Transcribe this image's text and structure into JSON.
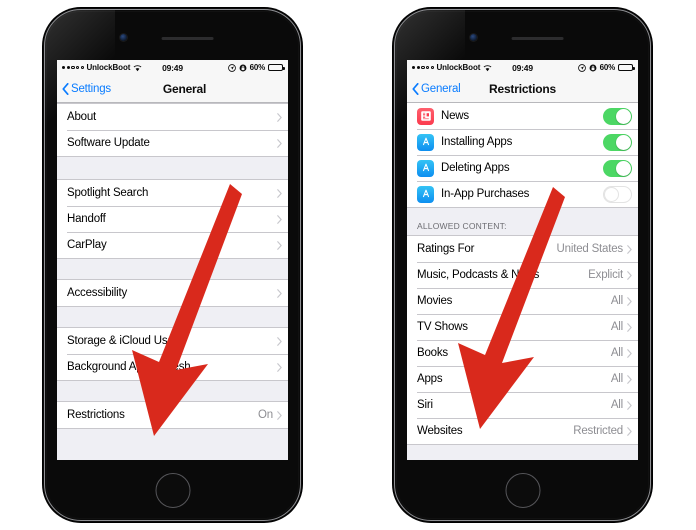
{
  "status_bar": {
    "carrier": "UnlockBoot",
    "time": "09:49",
    "battery_pct": "60%",
    "signal_dots_filled": 2,
    "signal_dots_total": 5,
    "wifi_icon": "wifi-icon",
    "location_icon": "location-arrow-icon",
    "lock_icon": "alarm-lock-icon",
    "battery_icon": "battery-icon"
  },
  "phones": [
    {
      "id": "left",
      "nav": {
        "back_label": "Settings",
        "back_icon": "chevron-left-icon",
        "title": "General"
      },
      "groups": [
        {
          "rows": [
            {
              "label": "About",
              "value": "",
              "accessory": "chevron-right-icon"
            },
            {
              "label": "Software Update",
              "value": "",
              "accessory": "chevron-right-icon"
            }
          ]
        },
        {
          "rows": [
            {
              "label": "Spotlight Search",
              "value": "",
              "accessory": "chevron-right-icon"
            },
            {
              "label": "Handoff",
              "value": "",
              "accessory": "chevron-right-icon"
            },
            {
              "label": "CarPlay",
              "value": "",
              "accessory": "chevron-right-icon"
            }
          ]
        },
        {
          "rows": [
            {
              "label": "Accessibility",
              "value": "",
              "accessory": "chevron-right-icon"
            }
          ]
        },
        {
          "rows": [
            {
              "label": "Storage & iCloud Usage",
              "value": "",
              "accessory": "chevron-right-icon"
            },
            {
              "label": "Background App Refresh",
              "value": "",
              "accessory": "chevron-right-icon"
            }
          ]
        },
        {
          "rows": [
            {
              "label": "Restrictions",
              "value": "On",
              "accessory": "chevron-right-icon"
            }
          ]
        }
      ]
    },
    {
      "id": "right",
      "nav": {
        "back_label": "General",
        "back_icon": "chevron-left-icon",
        "title": "Restrictions"
      },
      "toggle_rows": [
        {
          "label": "News",
          "icon": "news-app-icon",
          "icon_color": "#fb4a5a",
          "state": "on"
        },
        {
          "label": "Installing Apps",
          "icon": "app-store-icon",
          "icon_color": "#1aa3f0",
          "state": "on"
        },
        {
          "label": "Deleting Apps",
          "icon": "app-store-icon",
          "icon_color": "#1aa3f0",
          "state": "on"
        },
        {
          "label": "In-App Purchases",
          "icon": "app-store-icon",
          "icon_color": "#1aa3f0",
          "state": "off"
        }
      ],
      "section_header": "ALLOWED CONTENT:",
      "content_rows": [
        {
          "label": "Ratings For",
          "value": "United States",
          "accessory": "chevron-right-icon"
        },
        {
          "label": "Music, Podcasts & News",
          "value": "Explicit",
          "accessory": "chevron-right-icon"
        },
        {
          "label": "Movies",
          "value": "All",
          "accessory": "chevron-right-icon"
        },
        {
          "label": "TV Shows",
          "value": "All",
          "accessory": "chevron-right-icon"
        },
        {
          "label": "Books",
          "value": "All",
          "accessory": "chevron-right-icon"
        },
        {
          "label": "Apps",
          "value": "All",
          "accessory": "chevron-right-icon"
        },
        {
          "label": "Siri",
          "value": "All",
          "accessory": "chevron-right-icon"
        },
        {
          "label": "Websites",
          "value": "Restricted",
          "accessory": "chevron-right-icon"
        }
      ]
    }
  ],
  "annotations": {
    "arrow_color": "#d9291c",
    "left_arrow_target": "Restrictions",
    "right_arrow_target": "Websites"
  }
}
